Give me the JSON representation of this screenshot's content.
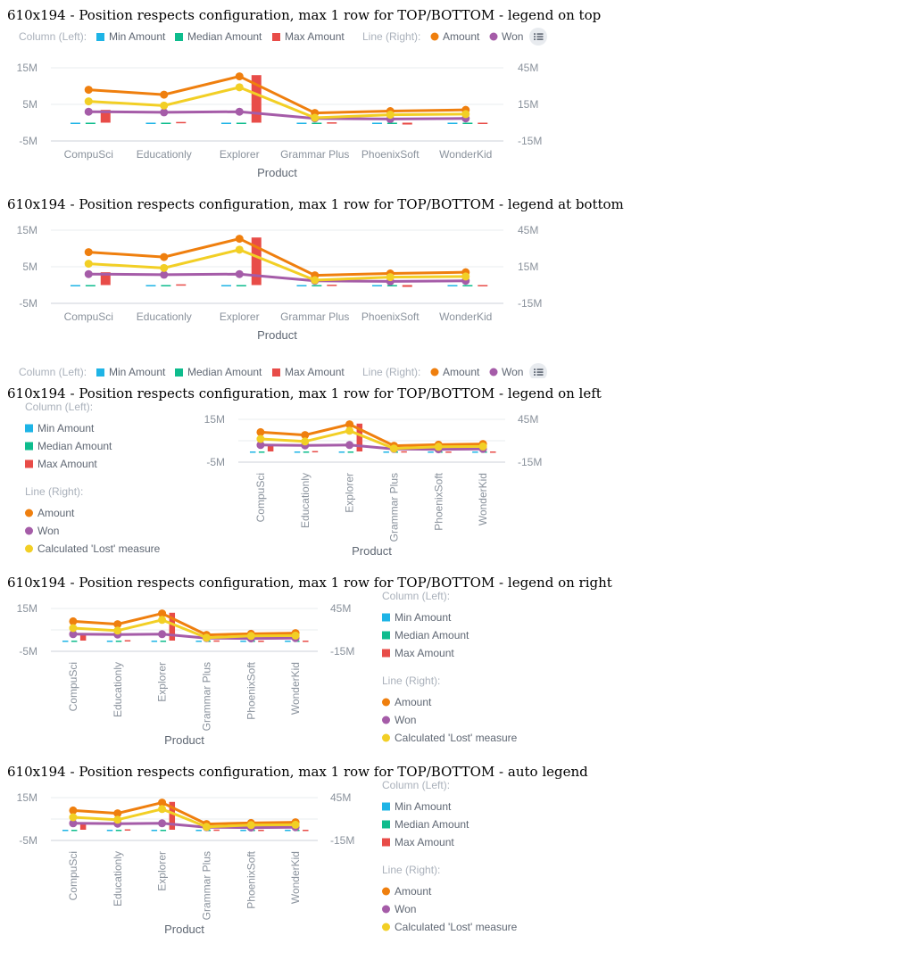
{
  "sections": [
    {
      "title": "610x194 - Position respects configuration, max 1 row for TOP/BOTTOM - legend on top",
      "legend_position": "top"
    },
    {
      "title": "610x194 - Position respects configuration, max 1 row for TOP/BOTTOM - legend at bottom",
      "legend_position": "bottom"
    },
    {
      "title": "610x194 - Position respects configuration, max 1 row for TOP/BOTTOM - legend on left",
      "legend_position": "left"
    },
    {
      "title": "610x194 - Position respects configuration, max 1 row for TOP/BOTTOM - legend on right",
      "legend_position": "right"
    },
    {
      "title": "610x194 - Position respects configuration, max 1 row for TOP/BOTTOM - auto legend",
      "legend_position": "auto"
    }
  ],
  "legend": {
    "column_group_label": "Column (Left):",
    "line_group_label": "Line (Right):",
    "more_icon": "list-icon"
  },
  "chart_data": {
    "type": "bar",
    "categories": [
      "CompuSci",
      "Educationly",
      "Explorer",
      "Grammar Plus",
      "PhoenixSoft",
      "WonderKid"
    ],
    "xlabel": "Product",
    "ylabel": "",
    "left_axis": {
      "ticks": [
        "15M",
        "5M",
        "-5M"
      ],
      "tick_values": [
        15,
        5,
        -5
      ],
      "ylim": [
        -5,
        15
      ]
    },
    "right_axis": {
      "ticks": [
        "45M",
        "15M",
        "-15M"
      ],
      "tick_values": [
        45,
        15,
        -15
      ],
      "ylim": [
        -15,
        45
      ]
    },
    "grid": true,
    "column_series": [
      {
        "name": "Min Amount",
        "color": "#1eb4e6",
        "values": [
          -0.2,
          -0.2,
          -0.3,
          -0.05,
          -0.05,
          -0.05
        ]
      },
      {
        "name": "Median Amount",
        "color": "#0ebc8d",
        "values": [
          -0.05,
          -0.05,
          -0.05,
          -0.05,
          -0.05,
          -0.05
        ]
      },
      {
        "name": "Max Amount",
        "color": "#e84c48",
        "values": [
          3.5,
          0.2,
          13,
          0.1,
          -0.5,
          -0.1
        ]
      }
    ],
    "line_series": [
      {
        "name": "Amount",
        "color": "#ef7f0e",
        "values": [
          27,
          23,
          38,
          8,
          9.5,
          10.5
        ]
      },
      {
        "name": "Won",
        "color": "#a55ca8",
        "values": [
          9,
          8.5,
          9,
          3.5,
          3,
          3.5
        ]
      },
      {
        "name": "Calculated 'Lost' measure",
        "color": "#f2cf25",
        "values": [
          17.5,
          14,
          29,
          4,
          6.5,
          7
        ]
      }
    ]
  }
}
